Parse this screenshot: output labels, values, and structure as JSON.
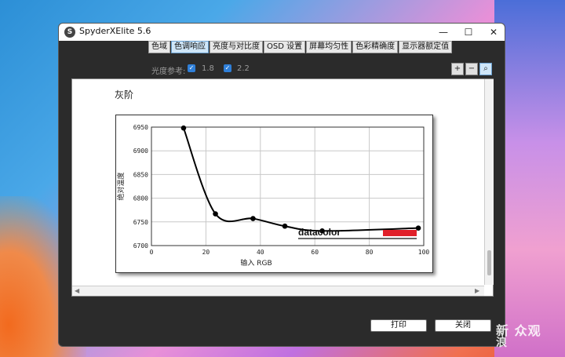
{
  "window": {
    "title": "SpyderXElite 5.6",
    "app_icon_letter": "S"
  },
  "window_controls": {
    "minimize": "—",
    "maximize": "☐",
    "close": "✕"
  },
  "tabs": [
    {
      "label": "色域"
    },
    {
      "label": "色调响应"
    },
    {
      "label": "亮度与对比度"
    },
    {
      "label": "OSD 设置"
    },
    {
      "label": "屏幕均匀性"
    },
    {
      "label": "色彩精确度"
    },
    {
      "label": "显示器额定值"
    }
  ],
  "active_tab": 1,
  "toolbar": {
    "ref_label": "光度参考:",
    "option_a": "1.8",
    "option_b": "2.2",
    "check_mark": "✓",
    "zoom_in": "+",
    "zoom_out": "−",
    "zoom_fit": "⌕"
  },
  "section": {
    "title": "灰阶"
  },
  "chart_data": {
    "type": "line",
    "xlabel": "输入 RGB",
    "ylabel": "绝对温度",
    "xlim": [
      0,
      100
    ],
    "ylim": [
      6700,
      6950
    ],
    "x_ticks": [
      0,
      20,
      40,
      60,
      80,
      100
    ],
    "y_ticks": [
      6700,
      6750,
      6800,
      6850,
      6900,
      6950
    ],
    "grid": true,
    "x": [
      11.8,
      23.5,
      37.3,
      49.0,
      62.7,
      98.0
    ],
    "y": [
      6948,
      6767,
      6757,
      6741,
      6731,
      6737
    ],
    "brand": "datacolor",
    "brand_accent": "#e0202a"
  },
  "buttons": {
    "print": "打印",
    "close": "关闭"
  },
  "scrollbar": {
    "left_arrow": "◀",
    "right_arrow": "▶"
  },
  "watermark": {
    "line1": "新 众观",
    "line2": "浪"
  }
}
